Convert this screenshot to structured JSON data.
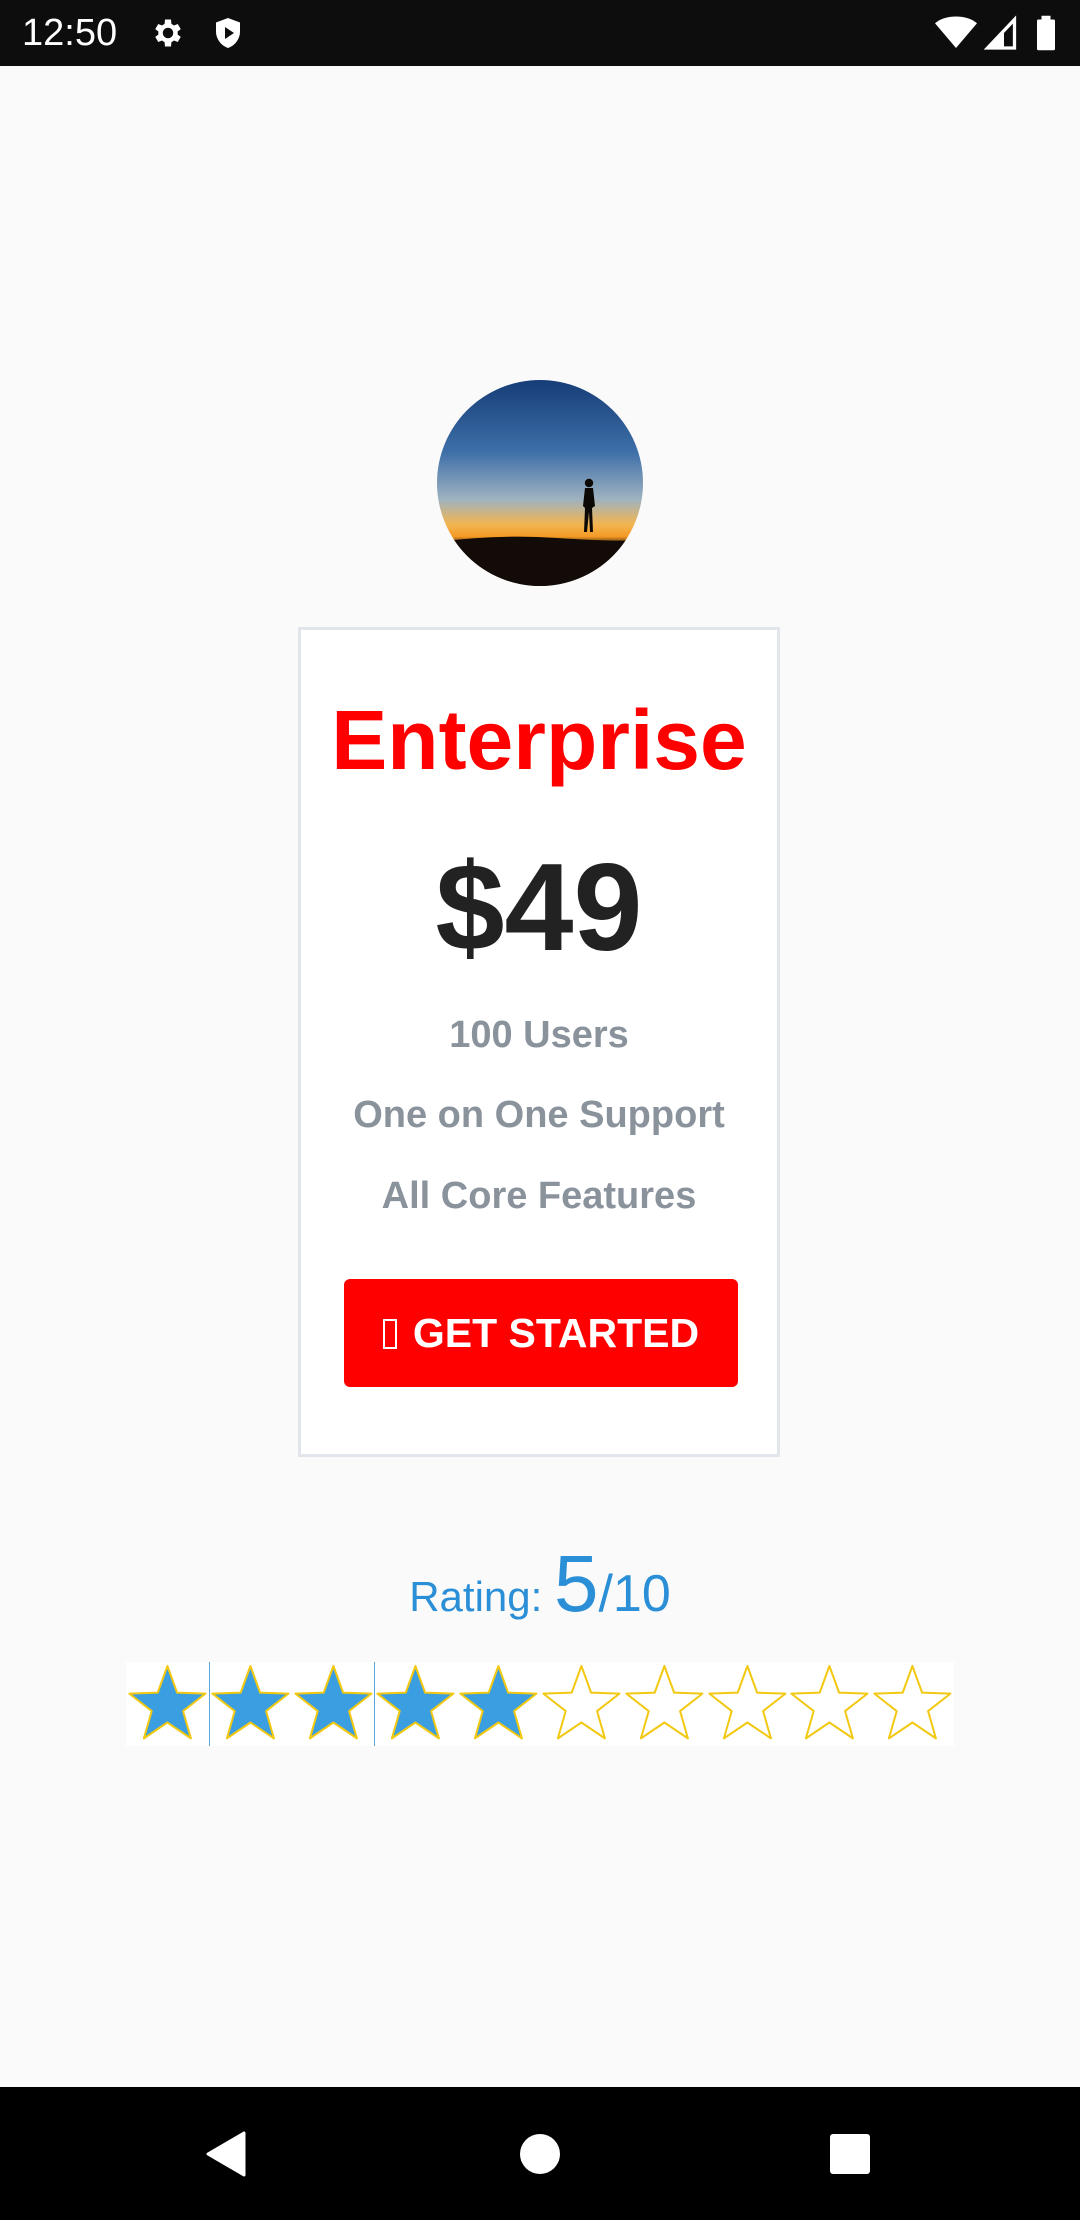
{
  "status_bar": {
    "time": "12:50",
    "icons": [
      "gear-icon",
      "shield-play-icon",
      "wifi-icon",
      "cellular-signal-icon",
      "battery-icon"
    ]
  },
  "avatar": {
    "description_icon": "sunset-silhouette-image"
  },
  "plan": {
    "title": "Enterprise",
    "price": "$49",
    "features": [
      "100 Users",
      "One on One Support",
      "All Core Features"
    ],
    "cta_label": "GET STARTED",
    "cta_icon": "missing-glyph-icon"
  },
  "rating": {
    "label": "Rating: ",
    "value": "5",
    "max": "/10",
    "score": 5,
    "total": 10
  },
  "colors": {
    "accent_red": "#ff0000",
    "rating_blue": "#2a8fd6",
    "star_filled": "#3a9ee0",
    "star_outline": "#f2c811",
    "text_gray": "#8a929c",
    "price_dark": "#222222"
  },
  "nav_bar": {
    "icons": [
      "back-icon",
      "home-icon",
      "recents-icon"
    ]
  }
}
